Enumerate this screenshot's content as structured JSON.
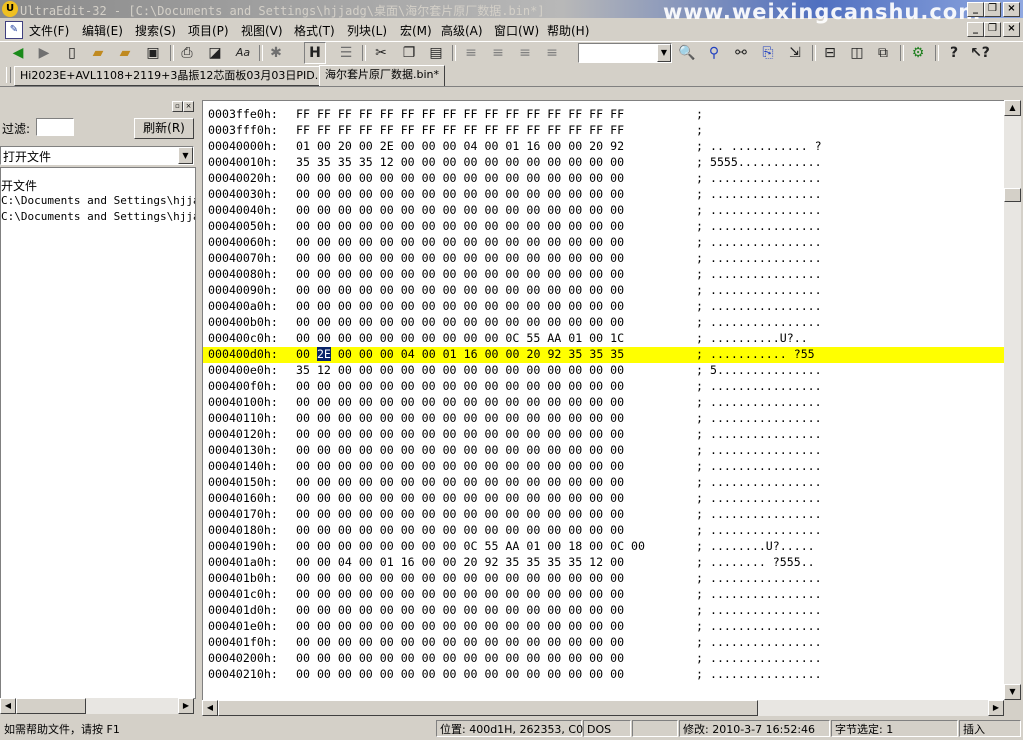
{
  "window": {
    "title": "UltraEdit-32 - [C:\\Documents and Settings\\hjjadg\\桌面\\海尔套片原厂数据.bin*]",
    "watermark": "www.weixingcanshu.com",
    "logo_text": "U"
  },
  "menu": [
    "文件(F)",
    "编辑(E)",
    "搜索(S)",
    "项目(P)",
    "视图(V)",
    "格式(T)",
    "列块(L)",
    "宏(M)",
    "高级(A)",
    "窗口(W)",
    "帮助(H)"
  ],
  "toolbar": {
    "icons": [
      "back-arrow-icon",
      "forward-arrow-icon",
      "new-file-icon",
      "open-folder-icon",
      "open-folder2-icon",
      "save-icon",
      "print-icon",
      "print-preview-icon",
      "spell-check-icon",
      "settings-icon",
      "hex-mode-icon",
      "format-icon",
      "cut-icon",
      "copy-icon",
      "paste-icon",
      "align-left-icon",
      "align-center-icon",
      "align-right-icon",
      "justify-icon",
      "find-icon",
      "find-in-files-icon",
      "replace-icon",
      "replace-in-files-icon",
      "goto-icon",
      "split-horizontal-icon",
      "split-vertical-icon",
      "cascade-icon",
      "toolbar-config-icon",
      "help-icon",
      "context-help-icon"
    ],
    "combo_value": ""
  },
  "tabs": [
    {
      "label": "Hi2023E+AVL1108+2119+3晶振12芯面板03月03日PID.bin",
      "active": false
    },
    {
      "label": "海尔套片原厂数据.bin*",
      "active": true
    }
  ],
  "left_pane": {
    "filter_label": "过滤:",
    "filter_value": "",
    "refresh_label": "刷新(R)",
    "open_files_option": "打开文件",
    "list": [
      "开文件",
      "C:\\Documents and Settings\\hjjadg",
      "C:\\Documents and Settings\\hjjadg"
    ]
  },
  "editor": {
    "rows": [
      {
        "addr": "0003ffe0h:",
        "bytes": "FF FF FF FF FF FF FF FF FF FF FF FF FF FF FF FF",
        "ascii": ";"
      },
      {
        "addr": "0003fff0h:",
        "bytes": "FF FF FF FF FF FF FF FF FF FF FF FF FF FF FF FF",
        "ascii": ";"
      },
      {
        "addr": "00040000h:",
        "bytes": "01 00 20 00 2E 00 00 00 04 00 01 16 00 00 20 92",
        "ascii": "; .. ........... ?"
      },
      {
        "addr": "00040010h:",
        "bytes": "35 35 35 35 12 00 00 00 00 00 00 00 00 00 00 00",
        "ascii": "; 5555............"
      },
      {
        "addr": "00040020h:",
        "bytes": "00 00 00 00 00 00 00 00 00 00 00 00 00 00 00 00",
        "ascii": "; ................"
      },
      {
        "addr": "00040030h:",
        "bytes": "00 00 00 00 00 00 00 00 00 00 00 00 00 00 00 00",
        "ascii": "; ................"
      },
      {
        "addr": "00040040h:",
        "bytes": "00 00 00 00 00 00 00 00 00 00 00 00 00 00 00 00",
        "ascii": "; ................"
      },
      {
        "addr": "00040050h:",
        "bytes": "00 00 00 00 00 00 00 00 00 00 00 00 00 00 00 00",
        "ascii": "; ................"
      },
      {
        "addr": "00040060h:",
        "bytes": "00 00 00 00 00 00 00 00 00 00 00 00 00 00 00 00",
        "ascii": "; ................"
      },
      {
        "addr": "00040070h:",
        "bytes": "00 00 00 00 00 00 00 00 00 00 00 00 00 00 00 00",
        "ascii": "; ................"
      },
      {
        "addr": "00040080h:",
        "bytes": "00 00 00 00 00 00 00 00 00 00 00 00 00 00 00 00",
        "ascii": "; ................"
      },
      {
        "addr": "00040090h:",
        "bytes": "00 00 00 00 00 00 00 00 00 00 00 00 00 00 00 00",
        "ascii": "; ................"
      },
      {
        "addr": "000400a0h:",
        "bytes": "00 00 00 00 00 00 00 00 00 00 00 00 00 00 00 00",
        "ascii": "; ................"
      },
      {
        "addr": "000400b0h:",
        "bytes": "00 00 00 00 00 00 00 00 00 00 00 00 00 00 00 00",
        "ascii": "; ................"
      },
      {
        "addr": "000400c0h:",
        "bytes": "00 00 00 00 00 00 00 00 00 00 0C 55 AA 01 00 1C",
        "ascii": "; ..........U?.."
      },
      {
        "addr": "000400d0h:",
        "bytes": "00 2E 00 00 00 04 00 01 16 00 00 20 92 35 35 35",
        "ascii": "; ........... ?55",
        "selected": true
      },
      {
        "addr": "000400e0h:",
        "bytes": "35 12 00 00 00 00 00 00 00 00 00 00 00 00 00 00",
        "ascii": "; 5..............."
      },
      {
        "addr": "000400f0h:",
        "bytes": "00 00 00 00 00 00 00 00 00 00 00 00 00 00 00 00",
        "ascii": "; ................"
      },
      {
        "addr": "00040100h:",
        "bytes": "00 00 00 00 00 00 00 00 00 00 00 00 00 00 00 00",
        "ascii": "; ................"
      },
      {
        "addr": "00040110h:",
        "bytes": "00 00 00 00 00 00 00 00 00 00 00 00 00 00 00 00",
        "ascii": "; ................"
      },
      {
        "addr": "00040120h:",
        "bytes": "00 00 00 00 00 00 00 00 00 00 00 00 00 00 00 00",
        "ascii": "; ................"
      },
      {
        "addr": "00040130h:",
        "bytes": "00 00 00 00 00 00 00 00 00 00 00 00 00 00 00 00",
        "ascii": "; ................"
      },
      {
        "addr": "00040140h:",
        "bytes": "00 00 00 00 00 00 00 00 00 00 00 00 00 00 00 00",
        "ascii": "; ................"
      },
      {
        "addr": "00040150h:",
        "bytes": "00 00 00 00 00 00 00 00 00 00 00 00 00 00 00 00",
        "ascii": "; ................"
      },
      {
        "addr": "00040160h:",
        "bytes": "00 00 00 00 00 00 00 00 00 00 00 00 00 00 00 00",
        "ascii": "; ................"
      },
      {
        "addr": "00040170h:",
        "bytes": "00 00 00 00 00 00 00 00 00 00 00 00 00 00 00 00",
        "ascii": "; ................"
      },
      {
        "addr": "00040180h:",
        "bytes": "00 00 00 00 00 00 00 00 00 00 00 00 00 00 00 00",
        "ascii": "; ................"
      },
      {
        "addr": "00040190h:",
        "bytes": "00 00 00 00 00 00 00 00 0C 55 AA 01 00 18 00 0C 00",
        "ascii": "; ........U?....."
      },
      {
        "addr": "000401a0h:",
        "bytes": "00 00 04 00 01 16 00 00 20 92 35 35 35 35 12 00",
        "ascii": "; ........ ?555.."
      },
      {
        "addr": "000401b0h:",
        "bytes": "00 00 00 00 00 00 00 00 00 00 00 00 00 00 00 00",
        "ascii": "; ................"
      },
      {
        "addr": "000401c0h:",
        "bytes": "00 00 00 00 00 00 00 00 00 00 00 00 00 00 00 00",
        "ascii": "; ................"
      },
      {
        "addr": "000401d0h:",
        "bytes": "00 00 00 00 00 00 00 00 00 00 00 00 00 00 00 00",
        "ascii": "; ................"
      },
      {
        "addr": "000401e0h:",
        "bytes": "00 00 00 00 00 00 00 00 00 00 00 00 00 00 00 00",
        "ascii": "; ................"
      },
      {
        "addr": "000401f0h:",
        "bytes": "00 00 00 00 00 00 00 00 00 00 00 00 00 00 00 00",
        "ascii": "; ................"
      },
      {
        "addr": "00040200h:",
        "bytes": "00 00 00 00 00 00 00 00 00 00 00 00 00 00 00 00",
        "ascii": "; ................"
      },
      {
        "addr": "00040210h:",
        "bytes": "00 00 00 00 00 00 00 00 00 00 00 00 00 00 00 00",
        "ascii": "; ................"
      }
    ],
    "selected_byte": "2E",
    "highlight_color": "#ffff00"
  },
  "status": {
    "help": "如需帮助文件，请按 F1",
    "position": "位置: 400d1H, 262353, C0",
    "format": "DOS",
    "modified": "修改: 2010-3-7 16:52:46",
    "selection": "字节选定: 1",
    "mode": "插入"
  }
}
